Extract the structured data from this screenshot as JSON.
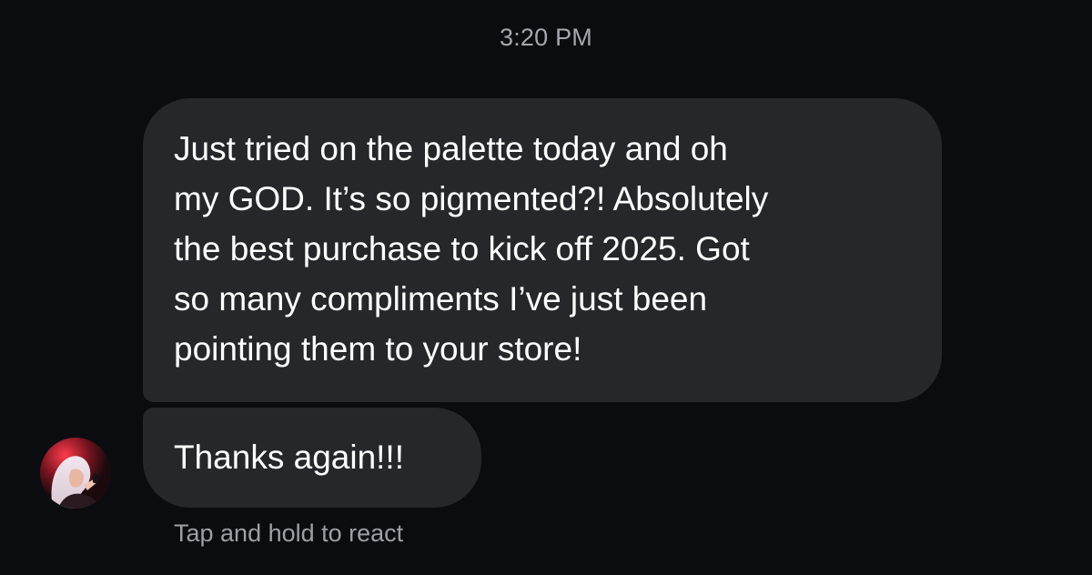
{
  "thread": {
    "timestamp": "3:20 PM",
    "messages": [
      {
        "text": "Just tried on the palette today and oh\nmy GOD. It’s so pigmented?! Absolutely\nthe best purchase to kick off 2025. Got\nso many compliments I’ve just been\npointing them to your store!"
      },
      {
        "text": "Thanks again!!!"
      }
    ],
    "react_hint": "Tap and hold to react"
  },
  "colors": {
    "background": "#0b0c10",
    "bubble": "#25272b",
    "text": "#ffffff",
    "muted_text": "#a4a7ad"
  },
  "sender": {
    "avatar": "avatar-photo-icon"
  }
}
